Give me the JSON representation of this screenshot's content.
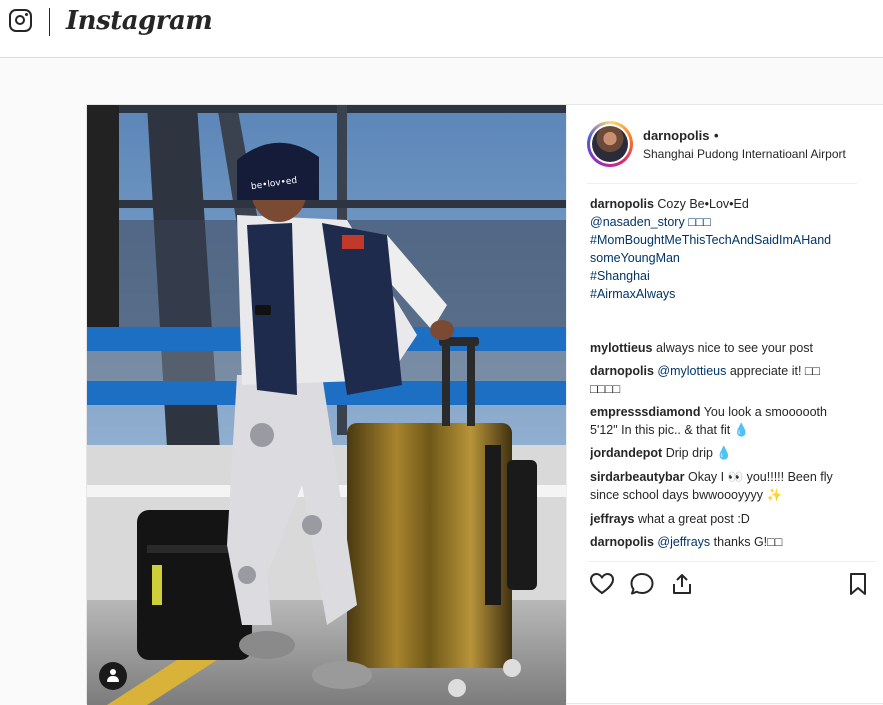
{
  "app": {
    "brand": "Instagram"
  },
  "post": {
    "username": "darnopolis",
    "follow_dot": "•",
    "location": "Shanghai Pudong Internatioanl Airport",
    "caption": {
      "user": "darnopolis",
      "lines": [
        "Cozy Be•Lov•Ed",
        "@nasaden_story □□□",
        "#MomBoughtMeThisTechAndSaidImAHand",
        "someYoungMan",
        "#Shanghai",
        "#AirmaxAlways"
      ]
    },
    "comments": [
      {
        "user": "mylottieus",
        "mention": "",
        "text": "always nice to see your post",
        "text2": ""
      },
      {
        "user": "darnopolis",
        "mention": "@mylottieus",
        "text": "appreciate it! □□",
        "text2": "□□□□"
      },
      {
        "user": "empresssdiamond",
        "mention": "",
        "text": "You look a smoooooth",
        "text2": "5'12\" In this pic.. & that fit 💧"
      },
      {
        "user": "jordandepot",
        "mention": "",
        "text": "Drip drip 💧",
        "text2": ""
      },
      {
        "user": "sirdarbeautybar",
        "mention": "",
        "text": "Okay I 👀 you!!!!! Been fly",
        "text2": "since school days bwwoooyyyy ✨"
      },
      {
        "user": "jeffrays",
        "mention": "",
        "text": "what a great post :D",
        "text2": ""
      },
      {
        "user": "darnopolis",
        "mention": "@jeffrays",
        "text": "thanks G!□□",
        "text2": ""
      }
    ],
    "actions": {
      "like_icon": "heart-icon",
      "comment_icon": "comment-icon",
      "share_icon": "share-icon",
      "save_icon": "bookmark-icon"
    },
    "photo_labels": {
      "beanie_text": "be•lov•ed"
    }
  },
  "colors": {
    "link": "#003569",
    "text": "#262626",
    "border": "#dbdbdb"
  }
}
